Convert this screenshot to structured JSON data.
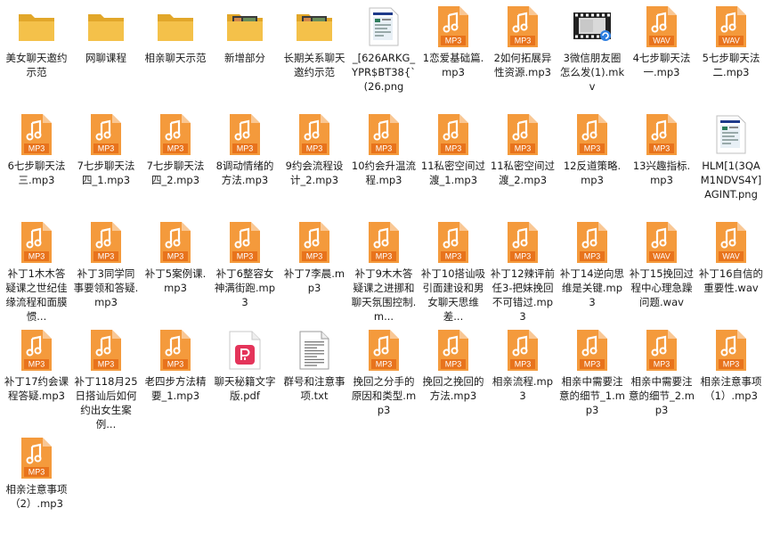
{
  "colors": {
    "folder": "#f4c14a",
    "folder_dark": "#e2a72a",
    "audio_orange": "#f49a3c",
    "audio_label": "#e8731c",
    "pdf_red": "#e4345a",
    "selection": "#e5f3ff"
  },
  "files": [
    {
      "name": "美女聊天邀约示范",
      "type": "folder",
      "icon": "folder-icon"
    },
    {
      "name": "网聊课程",
      "type": "folder",
      "icon": "folder-icon"
    },
    {
      "name": "相亲聊天示范",
      "type": "folder",
      "icon": "folder-icon"
    },
    {
      "name": "新增部分",
      "type": "folder",
      "icon": "folder-thumbnail-icon"
    },
    {
      "name": "长期关系聊天邀约示范",
      "type": "folder",
      "icon": "folder-thumbnail-icon"
    },
    {
      "name": "_[626ARKG_YPR$BT38{`(26.png",
      "type": "png",
      "icon": "image-file-icon"
    },
    {
      "name": "1恋爱基础篇.mp3",
      "type": "mp3",
      "icon": "mp3-file-icon",
      "badge": "MP3"
    },
    {
      "name": "2如何拓展异性资源.mp3",
      "type": "mp3",
      "icon": "mp3-file-icon",
      "badge": "MP3"
    },
    {
      "name": "3微信朋友圈怎么发(1).mkv",
      "type": "mkv",
      "icon": "video-file-icon"
    },
    {
      "name": "4七步聊天法一.mp3",
      "type": "wav",
      "icon": "wav-file-icon",
      "badge": "WAV"
    },
    {
      "name": "5七步聊天法二.mp3",
      "type": "wav",
      "icon": "wav-file-icon",
      "badge": "WAV"
    },
    {
      "name": "6七步聊天法三.mp3",
      "type": "mp3",
      "icon": "mp3-file-icon",
      "badge": "MP3"
    },
    {
      "name": "7七步聊天法四_1.mp3",
      "type": "mp3",
      "icon": "mp3-file-icon",
      "badge": "MP3"
    },
    {
      "name": "7七步聊天法四_2.mp3",
      "type": "mp3",
      "icon": "mp3-file-icon",
      "badge": "MP3"
    },
    {
      "name": "8调动情绪的方法.mp3",
      "type": "mp3",
      "icon": "mp3-file-icon",
      "badge": "MP3"
    },
    {
      "name": "9约会流程设计_2.mp3",
      "type": "mp3",
      "icon": "mp3-file-icon",
      "badge": "MP3"
    },
    {
      "name": "10约会升温流程.mp3",
      "type": "mp3",
      "icon": "mp3-file-icon",
      "badge": "MP3"
    },
    {
      "name": "11私密空间过渡_1.mp3",
      "type": "mp3",
      "icon": "mp3-file-icon",
      "badge": "MP3"
    },
    {
      "name": "11私密空间过渡_2.mp3",
      "type": "mp3",
      "icon": "mp3-file-icon",
      "badge": "MP3"
    },
    {
      "name": "12反道策略.mp3",
      "type": "mp3",
      "icon": "mp3-file-icon",
      "badge": "MP3"
    },
    {
      "name": "13兴趣指标.mp3",
      "type": "mp3",
      "icon": "mp3-file-icon",
      "badge": "MP3"
    },
    {
      "name": "HLM[1(3QAM1NDVS4Y]AGINT.png",
      "type": "png",
      "icon": "image-file-icon"
    },
    {
      "name": "补丁1木木答疑课之世纪佳缘流程和面膜惯...",
      "type": "mp3",
      "icon": "mp3-file-icon",
      "badge": "MP3"
    },
    {
      "name": "补丁3同学同事要领和答疑.mp3",
      "type": "mp3",
      "icon": "mp3-file-icon",
      "badge": "MP3"
    },
    {
      "name": "补丁5案例课.mp3",
      "type": "mp3",
      "icon": "mp3-file-icon",
      "badge": "MP3"
    },
    {
      "name": "补丁6整容女神满街跑.mp3",
      "type": "mp3",
      "icon": "mp3-file-icon",
      "badge": "MP3"
    },
    {
      "name": "补丁7李晨.mp3",
      "type": "mp3",
      "icon": "mp3-file-icon",
      "badge": "MP3"
    },
    {
      "name": "补丁9木木答疑课之进挪和聊天氛围控制.m...",
      "type": "mp3",
      "icon": "mp3-file-icon",
      "badge": "MP3"
    },
    {
      "name": "补丁10搭讪吸引面建设和男女聊天思维差...",
      "type": "mp3",
      "icon": "mp3-file-icon",
      "badge": "MP3"
    },
    {
      "name": "补丁12辣评前任3-把妹挽回不可错过.mp3",
      "type": "mp3",
      "icon": "mp3-file-icon",
      "badge": "MP3"
    },
    {
      "name": "补丁14逆向思维是关键.mp3",
      "type": "mp3",
      "icon": "mp3-file-icon",
      "badge": "MP3"
    },
    {
      "name": "补丁15挽回过程中心理急躁问题.wav",
      "type": "wav",
      "icon": "wav-file-icon",
      "badge": "WAV"
    },
    {
      "name": "补丁16自信的重要性.wav",
      "type": "wav",
      "icon": "wav-file-icon",
      "badge": "WAV"
    },
    {
      "name": "补丁17约会课程答疑.mp3",
      "type": "mp3",
      "icon": "mp3-file-icon",
      "badge": "MP3"
    },
    {
      "name": "补丁118月25日搭讪后如何约出女生案例...",
      "type": "mp3",
      "icon": "mp3-file-icon",
      "badge": "MP3"
    },
    {
      "name": "老四步方法精要_1.mp3",
      "type": "mp3",
      "icon": "mp3-file-icon",
      "badge": "MP3"
    },
    {
      "name": "聊天秘籍文字版.pdf",
      "type": "pdf",
      "icon": "pdf-file-icon"
    },
    {
      "name": "群号和注意事项.txt",
      "type": "txt",
      "icon": "text-file-icon"
    },
    {
      "name": "挽回之分手的原因和类型.mp3",
      "type": "mp3",
      "icon": "mp3-file-icon",
      "badge": "MP3"
    },
    {
      "name": "挽回之挽回的方法.mp3",
      "type": "mp3",
      "icon": "mp3-file-icon",
      "badge": "MP3"
    },
    {
      "name": "相亲流程.mp3",
      "type": "mp3",
      "icon": "mp3-file-icon",
      "badge": "MP3"
    },
    {
      "name": "相亲中需要注意的细节_1.mp3",
      "type": "mp3",
      "icon": "mp3-file-icon",
      "badge": "MP3"
    },
    {
      "name": "相亲中需要注意的细节_2.mp3",
      "type": "mp3",
      "icon": "mp3-file-icon",
      "badge": "MP3"
    },
    {
      "name": "相亲注意事项（1）.mp3",
      "type": "mp3",
      "icon": "mp3-file-icon",
      "badge": "MP3"
    },
    {
      "name": "相亲注意事项（2）.mp3",
      "type": "mp3",
      "icon": "mp3-file-icon",
      "badge": "MP3"
    }
  ]
}
